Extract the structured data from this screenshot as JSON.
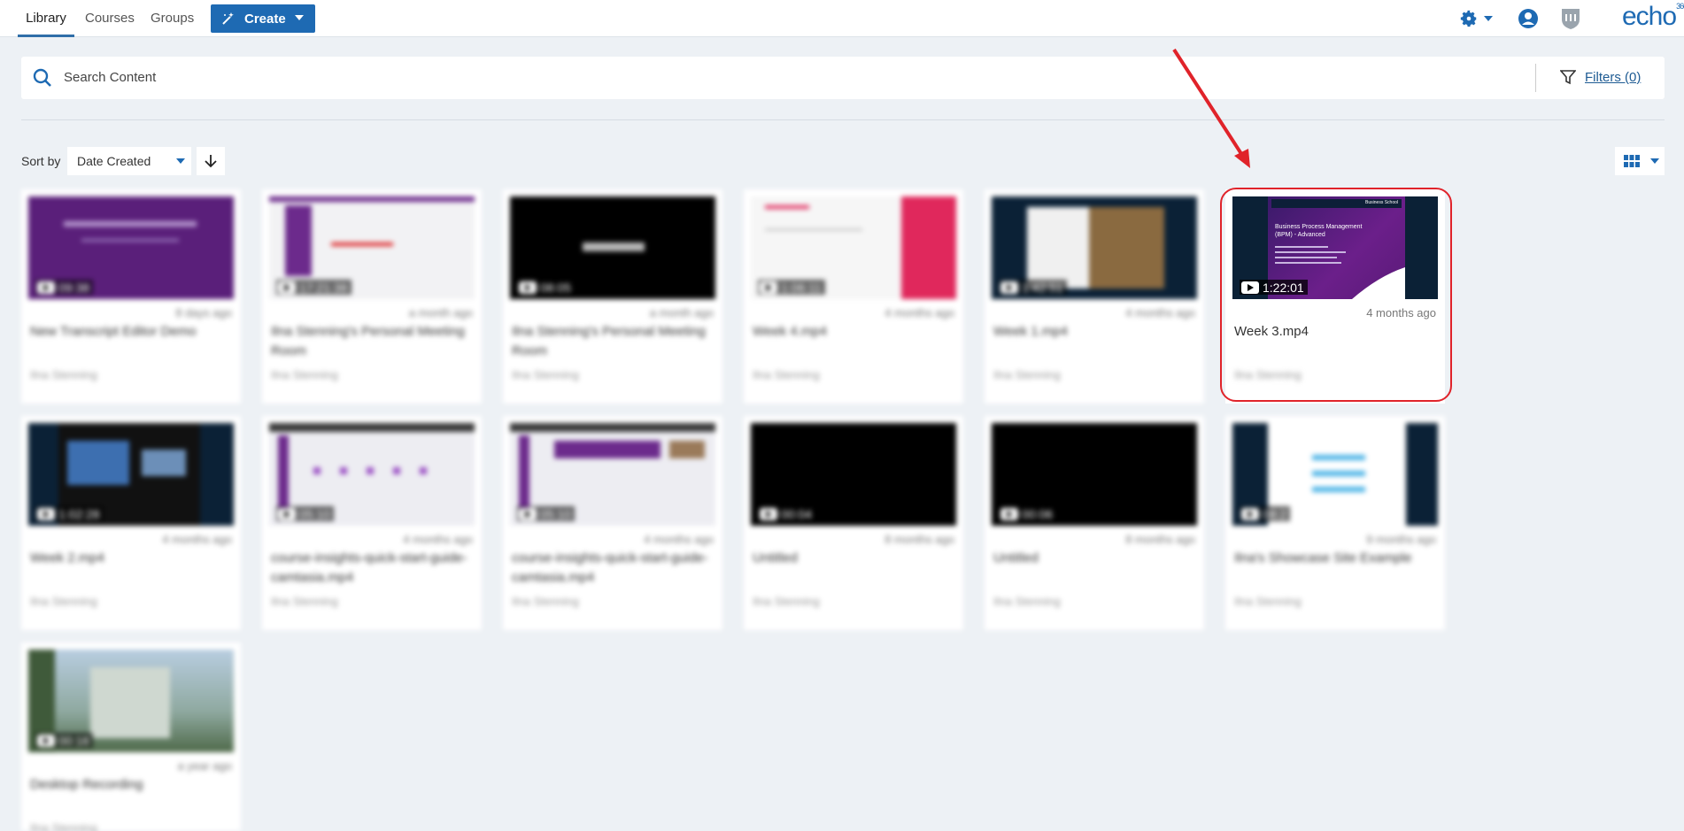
{
  "nav": {
    "tabs": [
      {
        "label": "Library"
      },
      {
        "label": "Courses"
      },
      {
        "label": "Groups"
      }
    ],
    "create_label": "Create",
    "logo_text": "echo",
    "logo_sup": "360",
    "accent": "#1e6ab3"
  },
  "search": {
    "placeholder": "Search Content",
    "filters_label": "Filters (0)"
  },
  "sort": {
    "label": "Sort by",
    "selected": "Date Created"
  },
  "cards": [
    {
      "duration": "09:38",
      "age": "8 days ago",
      "title": "New Transcript Editor Demo",
      "owner": "Ilna Stenning",
      "thumb": "#5a1f7a"
    },
    {
      "duration": "17:21:38",
      "age": "a month ago",
      "title": "Ilna Stenning's Personal Meeting Room",
      "owner": "Ilna Stenning",
      "thumb": "#f2f2f4"
    },
    {
      "duration": "08:05",
      "age": "a month ago",
      "title": "Ilna Stenning's Personal Meeting Room",
      "owner": "Ilna Stenning",
      "thumb": "#000000"
    },
    {
      "duration": "1:06:11",
      "age": "4 months ago",
      "title": "Week 4.mp4",
      "owner": "Ilna Stenning",
      "thumb": "#f6f6f6"
    },
    {
      "duration": "1:42:51",
      "age": "4 months ago",
      "title": "Week 1.mp4",
      "owner": "Ilna Stenning",
      "thumb": "#0b2136"
    },
    {
      "duration": "1:22:01",
      "age": "4 months ago",
      "title": "Week 3.mp4",
      "owner": "Ilna Stenning",
      "thumb": "#0b2136",
      "slide_title": "Business Process Management (BPM) - Advanced",
      "slide_header": "Business School"
    },
    {
      "duration": "1:02:28",
      "age": "4 months ago",
      "title": "Week 2.mp4",
      "owner": "Ilna Stenning",
      "thumb": "#0b2136"
    },
    {
      "duration": "05:10",
      "age": "4 months ago",
      "title": "course-insights-quick-start-guide-camtasia.mp4",
      "owner": "Ilna Stenning",
      "thumb": "#ededf2"
    },
    {
      "duration": "05:10",
      "age": "4 months ago",
      "title": "course-insights-quick-start-guide-camtasia.mp4",
      "owner": "Ilna Stenning",
      "thumb": "#ededf2"
    },
    {
      "duration": "00:04",
      "age": "8 months ago",
      "title": "Untitled",
      "owner": "Ilna Stenning",
      "thumb": "#000000"
    },
    {
      "duration": "00:06",
      "age": "8 months ago",
      "title": "Untitled",
      "owner": "Ilna Stenning",
      "thumb": "#000000"
    },
    {
      "duration": "08:2",
      "age": "9 months ago",
      "title": "Ilna's Showcase Site Example",
      "owner": "Ilna Stenning",
      "thumb": "#ffffff"
    },
    {
      "duration": "00:16",
      "age": "a year ago",
      "title": "Desktop Recording",
      "owner": "Ilna Stenning",
      "thumb": "#8fa9a0"
    }
  ],
  "highlight_color": "#e0232a"
}
